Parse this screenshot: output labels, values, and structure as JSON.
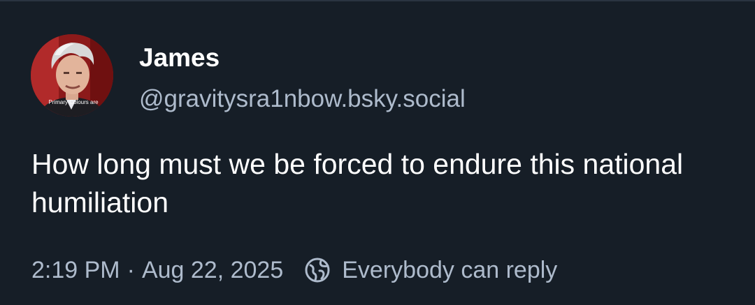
{
  "post": {
    "author": {
      "display_name": "James",
      "handle": "@gravitysra1nbow.bsky.social",
      "avatar_caption": "Primary Colours are"
    },
    "text": "How long must we be forced to endure this national humiliation",
    "time": "2:19 PM",
    "separator": "·",
    "date": "Aug 22, 2025",
    "reply_setting": "Everybody can reply",
    "reply_icon": "globe-icon"
  },
  "colors": {
    "background": "#161e27",
    "primary_text": "#ffffff",
    "secondary_text": "#aebbcc"
  }
}
